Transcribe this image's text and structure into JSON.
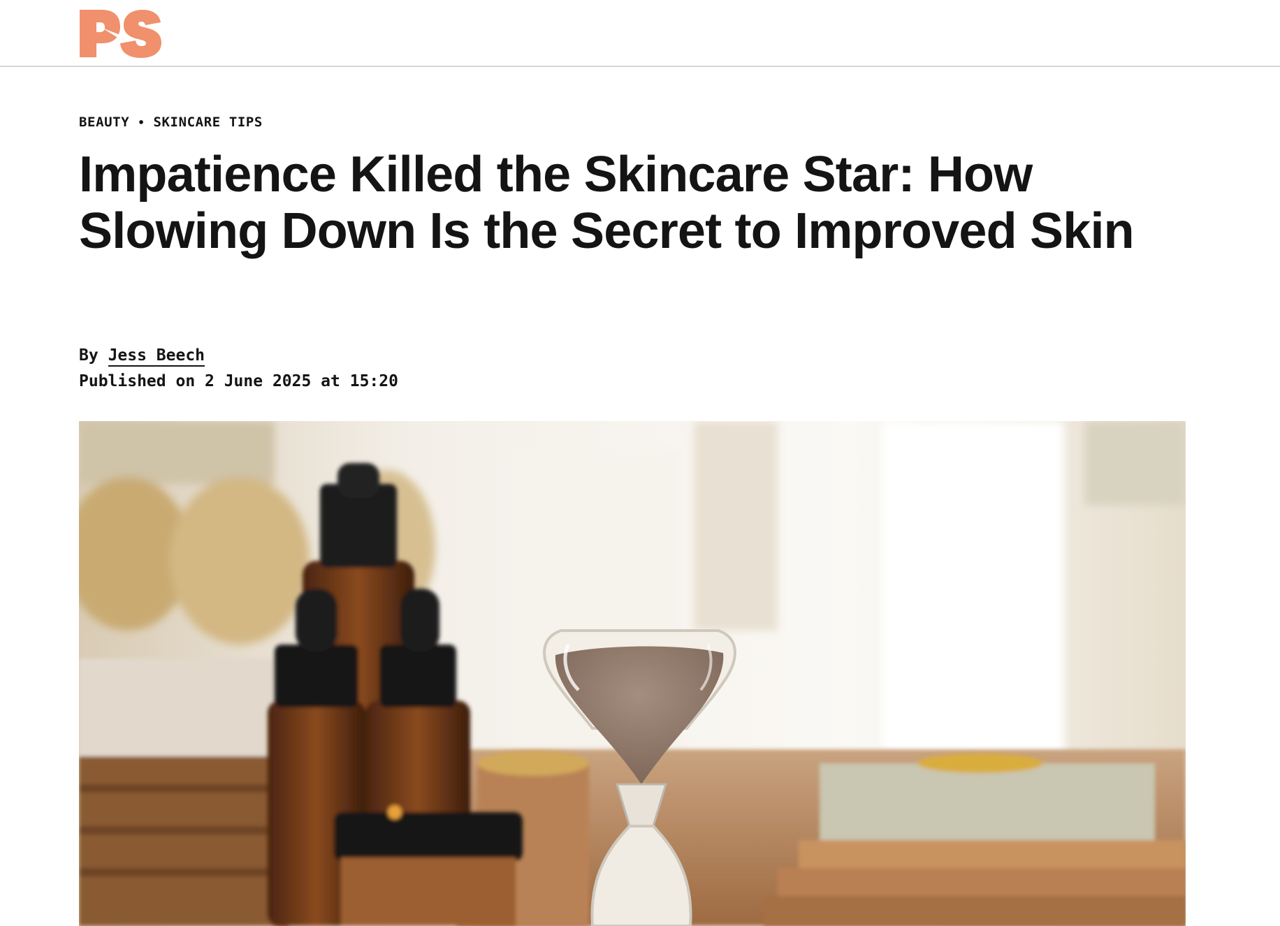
{
  "site": {
    "logo_text": "PS",
    "brand_color": "#f0906c"
  },
  "article": {
    "breadcrumb": {
      "section": "BEAUTY",
      "separator": "•",
      "subsection": "SKINCARE TIPS"
    },
    "title": "Impatience Killed the Skincare Star: How Slowing Down Is the Secret to Improved Skin",
    "byline_prefix": "By",
    "author": "Jess Beech",
    "published": "Published on 2 June 2025 at 15:20",
    "hero_image": {
      "subject": "hourglass with brown sand beside amber dropper bottles and rolled towels",
      "sand_color": "#8c7566",
      "bottle_color": "#6e3a1a"
    }
  }
}
